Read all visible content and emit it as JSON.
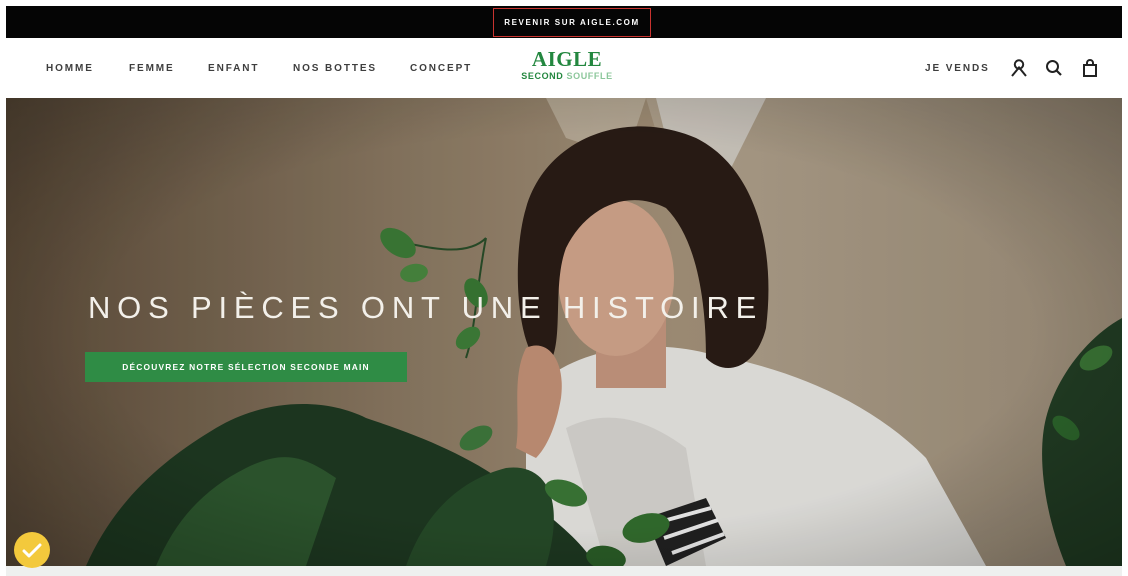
{
  "topbar": {
    "link_label": "REVENIR SUR AIGLE.COM"
  },
  "nav": {
    "items": [
      {
        "label": "HOMME"
      },
      {
        "label": "FEMME"
      },
      {
        "label": "ENFANT"
      },
      {
        "label": "NOS BOTTES"
      },
      {
        "label": "CONCEPT"
      }
    ],
    "sell_label": "JE VENDS"
  },
  "logo": {
    "main": "AIGLE",
    "sub_part1": "SECOND",
    "sub_part2": "SOUFFLE"
  },
  "hero": {
    "title": "NOS PIÈCES ONT UNE HISTOIRE",
    "cta_label": "DÉCOUVREZ NOTRE SÉLECTION SECONDE MAIN"
  },
  "icons": [
    "account-icon",
    "search-icon",
    "shopping-bag-icon",
    "chat-widget-icon"
  ],
  "colors": {
    "brand_green": "#23873f",
    "brand_light_green": "#8cc79b",
    "cta_green": "#2f8c45",
    "topbar": "#050505",
    "highlight_red": "#c8332f"
  }
}
